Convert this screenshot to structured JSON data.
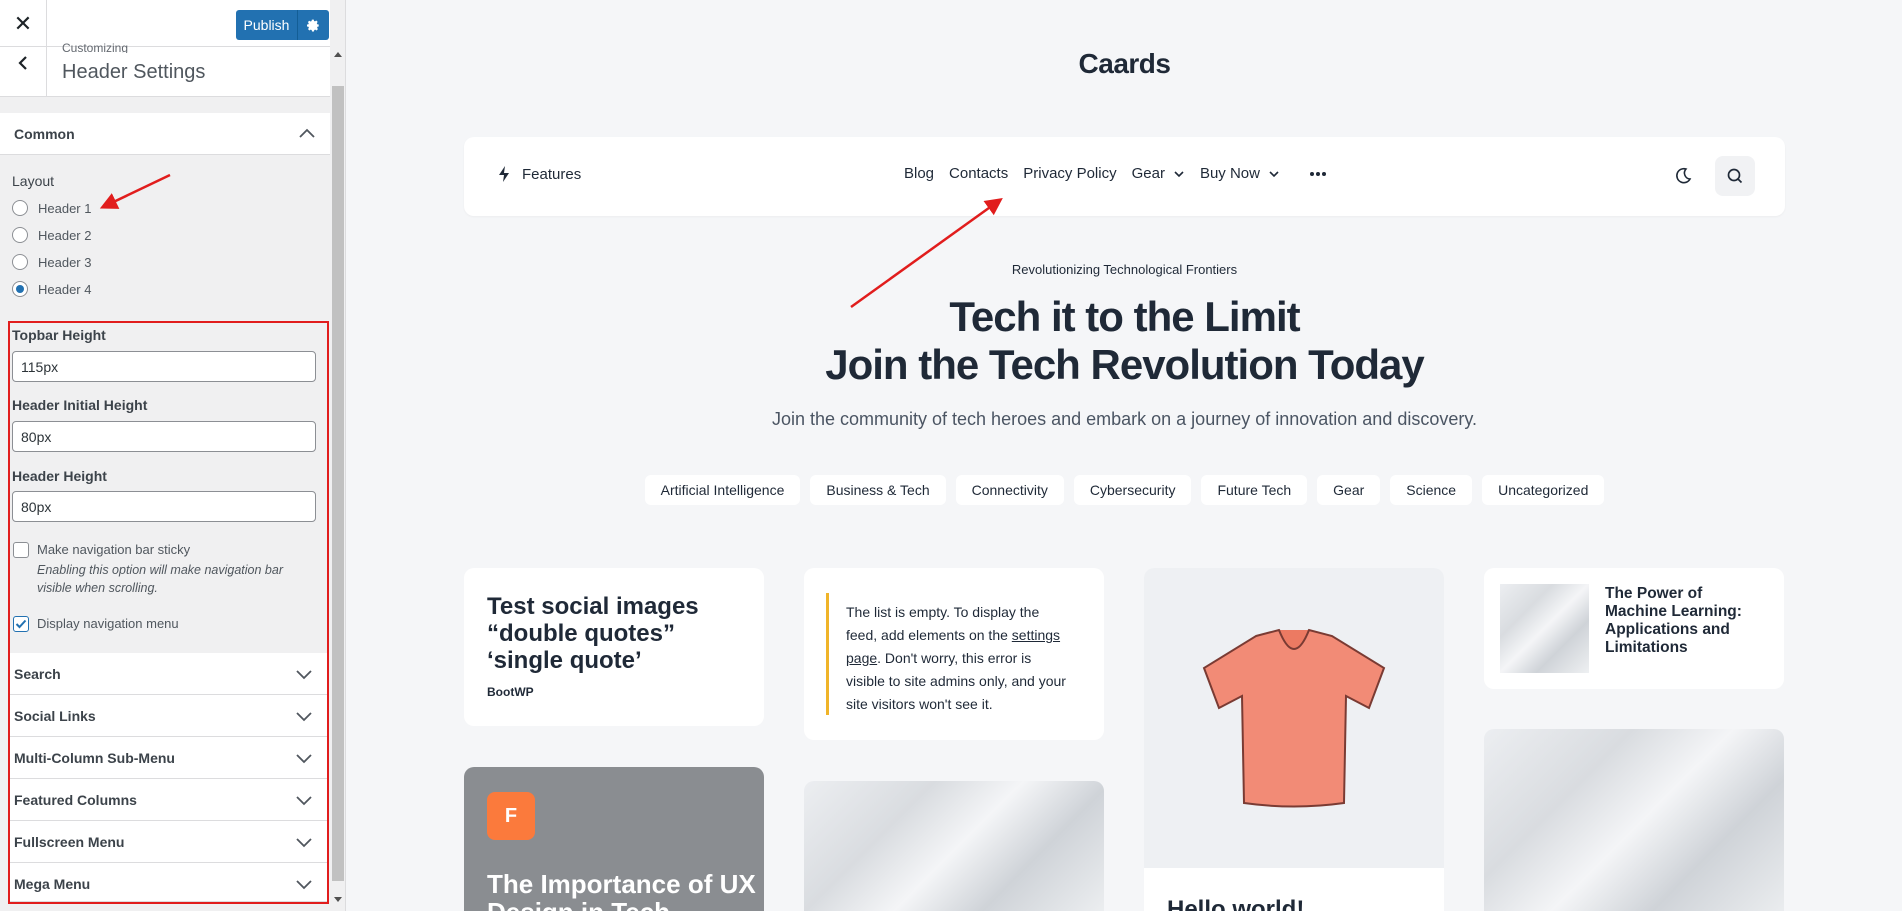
{
  "sidebar": {
    "close_icon": "close-icon",
    "publish_label": "Publish",
    "customizing_label": "Customizing",
    "section_title": "Header Settings",
    "common": {
      "title": "Common",
      "layout_label": "Layout",
      "layouts": [
        {
          "label": "Header 1",
          "checked": false
        },
        {
          "label": "Header 2",
          "checked": false
        },
        {
          "label": "Header 3",
          "checked": false
        },
        {
          "label": "Header 4",
          "checked": true
        }
      ],
      "topbar_height_label": "Topbar Height",
      "topbar_height_value": "115px",
      "header_initial_height_label": "Header Initial Height",
      "header_initial_height_value": "80px",
      "header_height_label": "Header Height",
      "header_height_value": "80px",
      "sticky_label": "Make navigation bar sticky",
      "sticky_checked": false,
      "sticky_desc": "Enabling this option will make navigation bar visible when scrolling.",
      "display_nav_label": "Display navigation menu",
      "display_nav_checked": true
    },
    "sections": [
      {
        "title": "Search"
      },
      {
        "title": "Social Links"
      },
      {
        "title": "Multi-Column Sub-Menu"
      },
      {
        "title": "Featured Columns"
      },
      {
        "title": "Fullscreen Menu"
      },
      {
        "title": "Mega Menu"
      }
    ]
  },
  "preview": {
    "site_title": "Caards",
    "nav": {
      "features_label": "Features",
      "items": [
        {
          "label": "Blog",
          "has_dropdown": false
        },
        {
          "label": "Contacts",
          "has_dropdown": false
        },
        {
          "label": "Privacy Policy",
          "has_dropdown": false
        },
        {
          "label": "Gear",
          "has_dropdown": true
        },
        {
          "label": "Buy Now",
          "has_dropdown": true
        }
      ]
    },
    "eyebrow": "Revolutionizing Technological Frontiers",
    "hero_line1": "Tech it to the Limit",
    "hero_line2": "Join the Tech Revolution Today",
    "hero_sub": "Join the community of tech heroes and embark on a journey of innovation and discovery.",
    "categories": [
      "Artificial Intelligence",
      "Business & Tech",
      "Connectivity",
      "Cybersecurity",
      "Future Tech",
      "Gear",
      "Science",
      "Uncategorized"
    ],
    "cards": {
      "social_title": "Test social images “double quotes” ‘single quote’",
      "social_author": "BootWP",
      "feed_text_1": "The list is empty. To display the feed, add elements on the ",
      "feed_link": "settings page",
      "feed_text_2": ". Don't worry, this error is visible to site admins only, and your site visitors won't see it.",
      "ml_title": "The Power of Machine Learning: Applications and Limitations",
      "ux_badge": "F",
      "ux_title": "The Importance of UX Design in Tech",
      "hello_title": "Hello world!"
    }
  },
  "colors": {
    "accent_blue": "#2271b1",
    "annotation_red": "#e11d1d",
    "badge_orange": "#fb7a3c"
  }
}
